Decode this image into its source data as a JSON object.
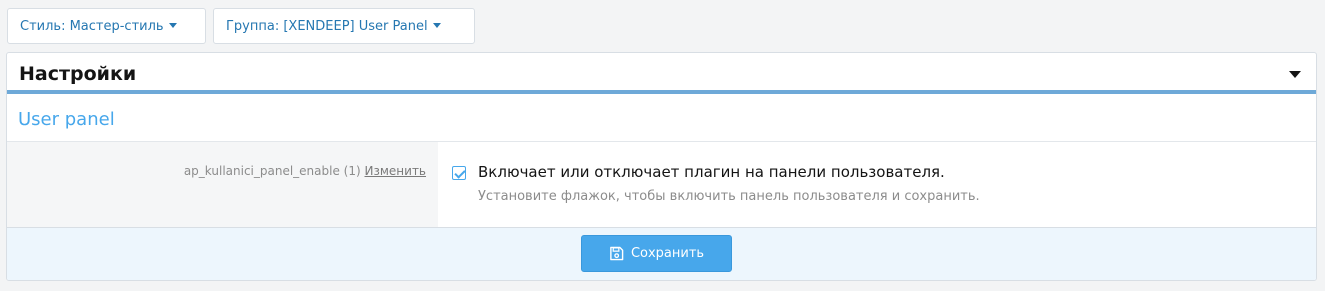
{
  "filters": {
    "style_label": "Стиль: Мастер-стиль",
    "group_label": "Группа: [XENDEEP] User Panel"
  },
  "block": {
    "title": "Настройки"
  },
  "section": {
    "title": "User panel"
  },
  "option": {
    "key": "ap_kullanici_panel_enable (1)",
    "edit_link": "Изменить",
    "checked": true,
    "label": "Включает или отключает плагин на панели пользователя.",
    "hint": "Установите флажок, чтобы включить панель пользователя и сохранить."
  },
  "footer": {
    "save_label": "Сохранить"
  },
  "icons": {
    "dropdown": "caret-down-icon",
    "save": "floppy-disk-icon",
    "checkbox": "checkmark-icon"
  },
  "colors": {
    "accent": "#47a7eb",
    "link": "#2577b1",
    "header_rule": "#6ea9d8",
    "footer_bg": "#edf6fd"
  }
}
